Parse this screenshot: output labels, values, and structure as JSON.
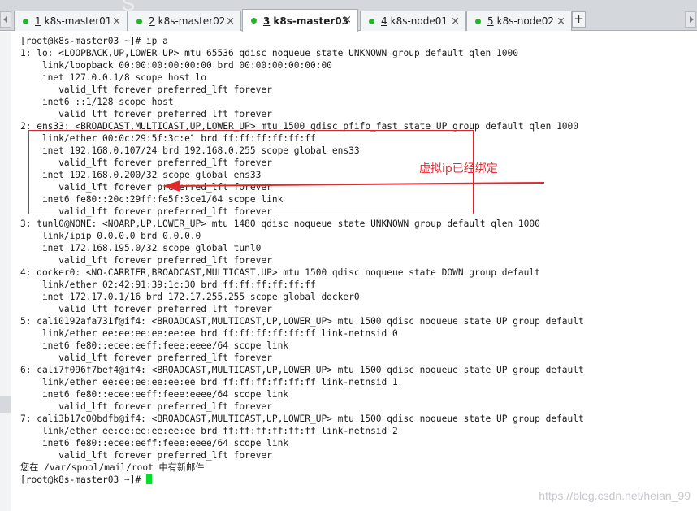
{
  "tabs": [
    {
      "number": "1",
      "label": "k8s-master01",
      "active": false
    },
    {
      "number": "2",
      "label": "k8s-master02",
      "active": false
    },
    {
      "number": "3",
      "label": "k8s-master03",
      "active": true
    },
    {
      "number": "4",
      "label": "k8s-node01",
      "active": false
    },
    {
      "number": "5",
      "label": "k8s-node02",
      "active": false
    }
  ],
  "tab_close_symbol": "×",
  "tab_add_symbol": "+",
  "terminal_lines": [
    "[root@k8s-master03 ~]# ip a",
    "1: lo: <LOOPBACK,UP,LOWER_UP> mtu 65536 qdisc noqueue state UNKNOWN group default qlen 1000",
    "    link/loopback 00:00:00:00:00:00 brd 00:00:00:00:00:00",
    "    inet 127.0.0.1/8 scope host lo",
    "       valid_lft forever preferred_lft forever",
    "    inet6 ::1/128 scope host",
    "       valid_lft forever preferred_lft forever",
    "2: ens33: <BROADCAST,MULTICAST,UP,LOWER_UP> mtu 1500 qdisc pfifo_fast state UP group default qlen 1000",
    "    link/ether 00:0c:29:5f:3c:e1 brd ff:ff:ff:ff:ff:ff",
    "    inet 192.168.0.107/24 brd 192.168.0.255 scope global ens33",
    "       valid_lft forever preferred_lft forever",
    "    inet 192.168.0.200/32 scope global ens33",
    "       valid_lft forever preferred_lft forever",
    "    inet6 fe80::20c:29ff:fe5f:3ce1/64 scope link",
    "       valid_lft forever preferred_lft forever",
    "3: tunl0@NONE: <NOARP,UP,LOWER_UP> mtu 1480 qdisc noqueue state UNKNOWN group default qlen 1000",
    "    link/ipip 0.0.0.0 brd 0.0.0.0",
    "    inet 172.168.195.0/32 scope global tunl0",
    "       valid_lft forever preferred_lft forever",
    "4: docker0: <NO-CARRIER,BROADCAST,MULTICAST,UP> mtu 1500 qdisc noqueue state DOWN group default",
    "    link/ether 02:42:91:39:1c:30 brd ff:ff:ff:ff:ff:ff",
    "    inet 172.17.0.1/16 brd 172.17.255.255 scope global docker0",
    "       valid_lft forever preferred_lft forever",
    "5: cali0192afa731f@if4: <BROADCAST,MULTICAST,UP,LOWER_UP> mtu 1500 qdisc noqueue state UP group default",
    "    link/ether ee:ee:ee:ee:ee:ee brd ff:ff:ff:ff:ff:ff link-netnsid 0",
    "    inet6 fe80::ecee:eeff:feee:eeee/64 scope link",
    "       valid_lft forever preferred_lft forever",
    "6: cali7f096f7bef4@if4: <BROADCAST,MULTICAST,UP,LOWER_UP> mtu 1500 qdisc noqueue state UP group default",
    "    link/ether ee:ee:ee:ee:ee:ee brd ff:ff:ff:ff:ff:ff link-netnsid 1",
    "    inet6 fe80::ecee:eeff:feee:eeee/64 scope link",
    "       valid_lft forever preferred_lft forever",
    "7: cali3b17c00bdfb@if4: <BROADCAST,MULTICAST,UP,LOWER_UP> mtu 1500 qdisc noqueue state UP group default",
    "    link/ether ee:ee:ee:ee:ee:ee brd ff:ff:ff:ff:ff:ff link-netnsid 2",
    "    inet6 fe80::ecee:eeff:feee:eeee/64 scope link",
    "       valid_lft forever preferred_lft forever",
    "您在 /var/spool/mail/root 中有新邮件"
  ],
  "prompt": "[root@k8s-master03 ~]# ",
  "annotation": {
    "text": "虚拟ip已经绑定",
    "color": "#e0292f"
  },
  "watermark": "https://blog.csdn.net/heian_99",
  "colors": {
    "status_dot": "#27b12f",
    "cursor": "#00e02a",
    "annotation_red": "#d9262c"
  }
}
